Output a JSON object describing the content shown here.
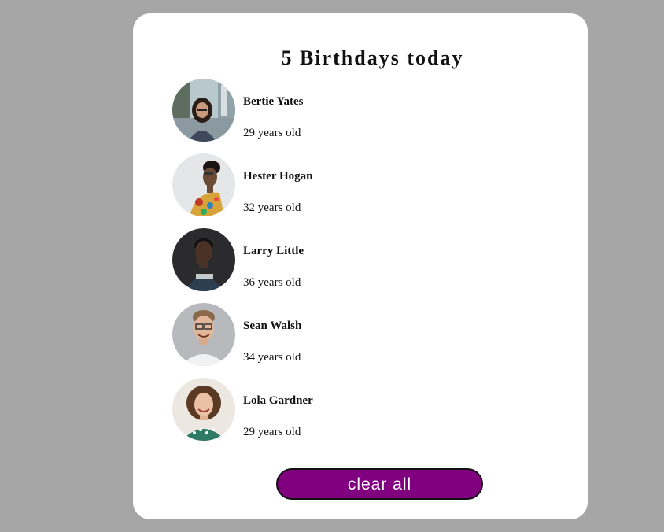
{
  "header": {
    "title": "5 Birthdays today"
  },
  "people": [
    {
      "name": "Bertie Yates",
      "age": "29 years old",
      "avatar_icon": "avatar-photo-woman-glasses-street"
    },
    {
      "name": "Hester Hogan",
      "age": "32 years old",
      "avatar_icon": "avatar-photo-woman-profile-colorful"
    },
    {
      "name": "Larry Little",
      "age": "36 years old",
      "avatar_icon": "avatar-photo-man-dark-background"
    },
    {
      "name": "Sean Walsh",
      "age": "34 years old",
      "avatar_icon": "avatar-photo-man-glasses-smiling"
    },
    {
      "name": "Lola Gardner",
      "age": "29 years old",
      "avatar_icon": "avatar-photo-woman-curly-hair"
    }
  ],
  "actions": {
    "clear_label": "clear all"
  },
  "colors": {
    "page_background": "#a6a6a6",
    "card_background": "#ffffff",
    "button_background": "#800080",
    "button_text": "#ffffff"
  }
}
